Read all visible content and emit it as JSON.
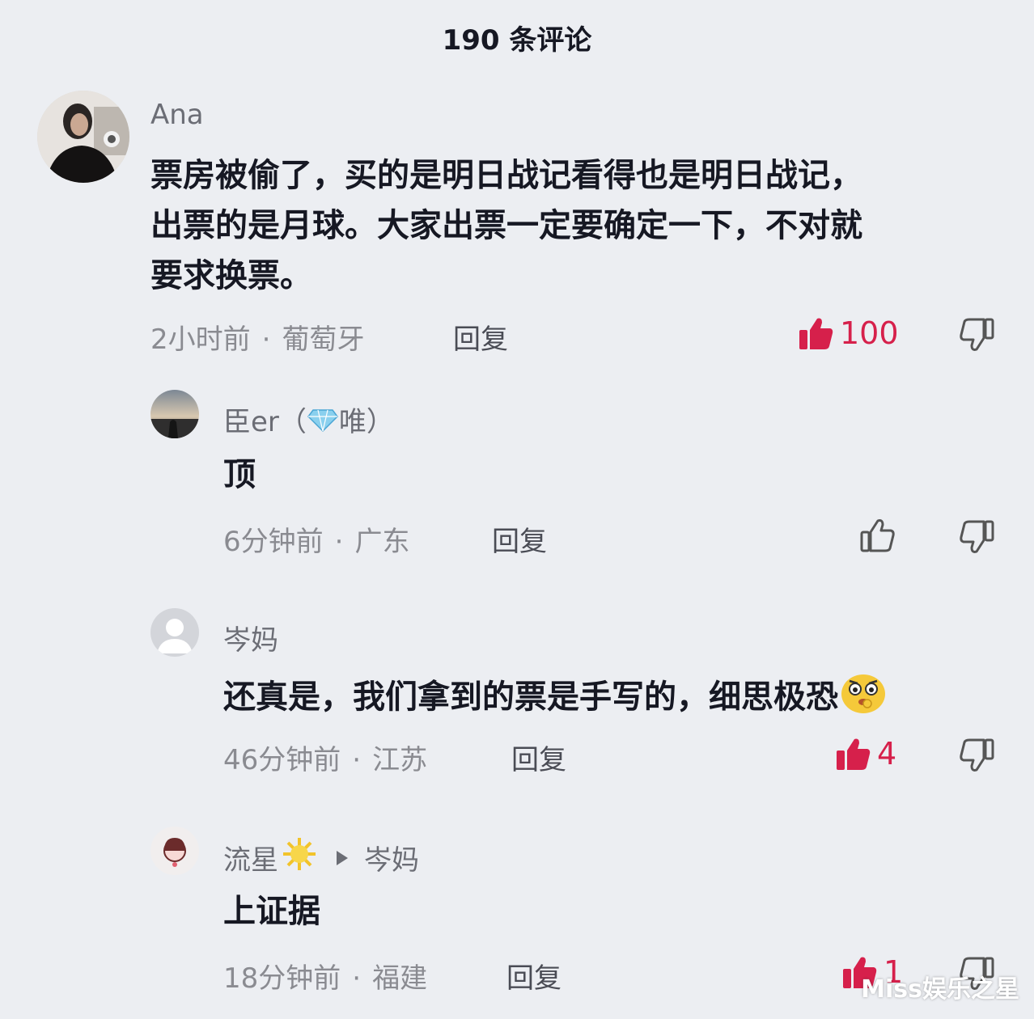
{
  "header": {
    "title": "190 条评论"
  },
  "comments": [
    {
      "username": "Ana",
      "text_lines": [
        "票房被偷了，买的是明日战记看得也是明日战记，",
        "出票的是月球。大家出票一定要确定一下，不对就",
        "要求换票。"
      ],
      "time": "2小时前",
      "location": "葡萄牙",
      "reply_label": "回复",
      "likes": "100",
      "liked": true
    },
    {
      "username": "臣er（",
      "username_suffix": "唯）",
      "text": "顶",
      "time": "6分钟前",
      "location": "广东",
      "reply_label": "回复",
      "likes": "",
      "liked": false
    },
    {
      "username": "岑妈",
      "text": "还真是，我们拿到的票是手写的，细思极恐",
      "time": "46分钟前",
      "location": "江苏",
      "reply_label": "回复",
      "likes": "4",
      "liked": true
    },
    {
      "username": "流星",
      "reply_to": "岑妈",
      "text": "上证据",
      "time": "18分钟前",
      "location": "福建",
      "reply_label": "回复",
      "likes": "1",
      "liked": true
    }
  ],
  "colors": {
    "accent": "#d6204b",
    "background": "#eceef2"
  },
  "watermark": "Miss娱乐之星"
}
